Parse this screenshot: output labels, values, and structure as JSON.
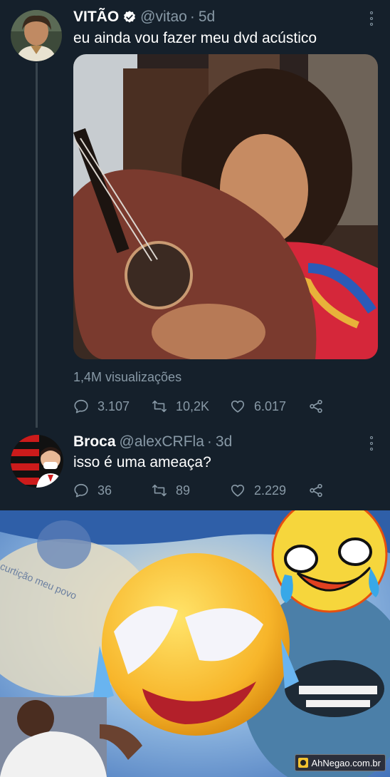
{
  "tweet": {
    "author_name": "VITÃO",
    "author_handle": "@vitao",
    "separator": "·",
    "time": "5d",
    "text": "eu ainda vou fazer meu dvd acústico",
    "views": "1,4M visualizações",
    "actions": {
      "replies": "3.107",
      "retweets": "10,2K",
      "likes": "6.017"
    }
  },
  "reply": {
    "author_name": "Broca",
    "author_handle": "@alexCRFla",
    "separator": "·",
    "time": "3d",
    "text": "isso é uma ameaça?",
    "actions": {
      "replies": "36",
      "retweets": "89",
      "likes": "2.229"
    }
  },
  "meme": {
    "caption": "curtição meu povo",
    "watermark": "AhNegao.com.br"
  },
  "colors": {
    "background": "#15202b",
    "secondary_text": "#8899a6",
    "thread_line": "#38444d",
    "verified": "#ffffff"
  }
}
